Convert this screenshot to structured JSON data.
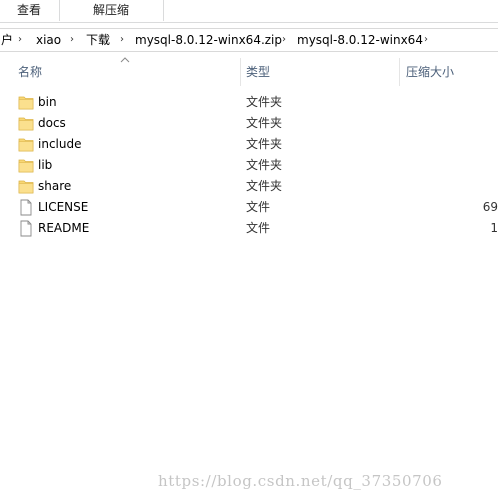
{
  "ribbon": {
    "tabs": [
      {
        "label": "查看"
      },
      {
        "label": "解压缩"
      }
    ]
  },
  "address_bar": {
    "crumbs": [
      {
        "label": "户"
      },
      {
        "label": "xiao"
      },
      {
        "label": "下载"
      },
      {
        "label": "mysql-8.0.12-winx64.zip"
      },
      {
        "label": "mysql-8.0.12-winx64"
      }
    ]
  },
  "columns": {
    "name": "名称",
    "type": "类型",
    "compressed_size": "压缩大小"
  },
  "files": [
    {
      "name": "bin",
      "type": "文件夹",
      "size": "",
      "icon": "folder-icon"
    },
    {
      "name": "docs",
      "type": "文件夹",
      "size": "",
      "icon": "folder-icon"
    },
    {
      "name": "include",
      "type": "文件夹",
      "size": "",
      "icon": "folder-icon"
    },
    {
      "name": "lib",
      "type": "文件夹",
      "size": "",
      "icon": "folder-icon"
    },
    {
      "name": "share",
      "type": "文件夹",
      "size": "",
      "icon": "folder-icon"
    },
    {
      "name": "LICENSE",
      "type": "文件",
      "size": "69",
      "icon": "document-icon"
    },
    {
      "name": "README",
      "type": "文件",
      "size": "1",
      "icon": "document-icon"
    }
  ],
  "watermark": "https://blog.csdn.net/qq_37350706",
  "colors": {
    "folder": "#f8d775",
    "header_text": "#4c607a"
  }
}
